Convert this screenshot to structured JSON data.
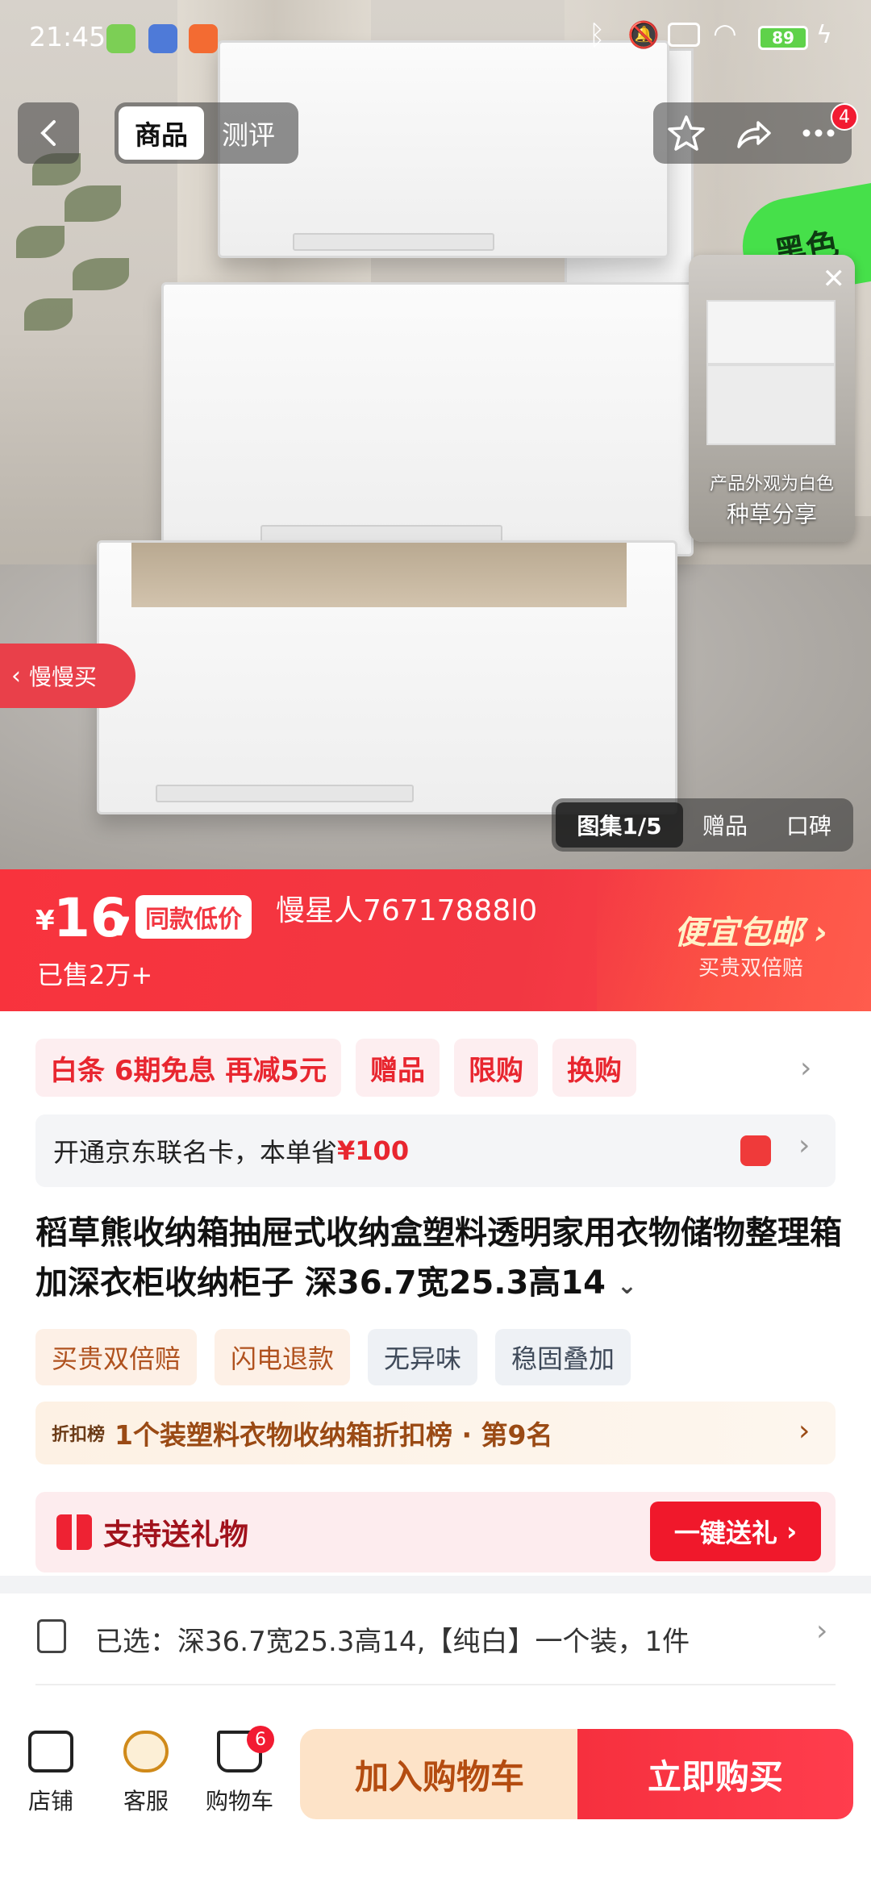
{
  "status_bar": {
    "time": "21:45",
    "battery": "89"
  },
  "nav": {
    "tabs": [
      "商品",
      "测评"
    ],
    "more_badge": "4"
  },
  "float_video": {
    "overlay_text": "产品外观为白色",
    "caption": "种草分享"
  },
  "hero": {
    "green_label": "黑色",
    "slow_buy": "慢慢买"
  },
  "gallery": {
    "current": "图集1/5",
    "gift": "赠品",
    "reviews": "口碑"
  },
  "price": {
    "currency": "¥",
    "integer": "16",
    "decimal": ".7",
    "same_low": "同款低价",
    "user_tag": "慢星人76717888l0",
    "sold": "已售2万+",
    "cheap_shipping": "便宜包邮",
    "cheap_sub": "买贵双倍赔"
  },
  "promotions": [
    "白条  6期免息 再减5元",
    "赠品",
    "限购",
    "换购"
  ],
  "card": {
    "text": "开通京东联名卡，本单省",
    "amount": "¥100"
  },
  "product_title": "稻草熊收纳箱抽屉式收纳盒塑料透明家用衣物储物整理箱加深衣柜收纳柜子 深36.7宽25.3高14",
  "tags": [
    {
      "label": "买贵双倍赔"
    },
    {
      "label": "闪电退款"
    },
    {
      "label": "无异味"
    },
    {
      "label": "稳固叠加"
    }
  ],
  "rank": {
    "badge": "折扣榜",
    "text": "1个装塑料衣物收纳箱折扣榜 · 第9名"
  },
  "gift": {
    "label": "支持送礼物",
    "button": "一键送礼"
  },
  "selection": {
    "text": "已选：深36.7宽25.3高14,【纯白】一个装，1件"
  },
  "bottom_bar": {
    "shop": "店铺",
    "service": "客服",
    "cart": "购物车",
    "cart_badge": "6",
    "add_to_cart": "加入购物车",
    "buy_now": "立即购买"
  }
}
